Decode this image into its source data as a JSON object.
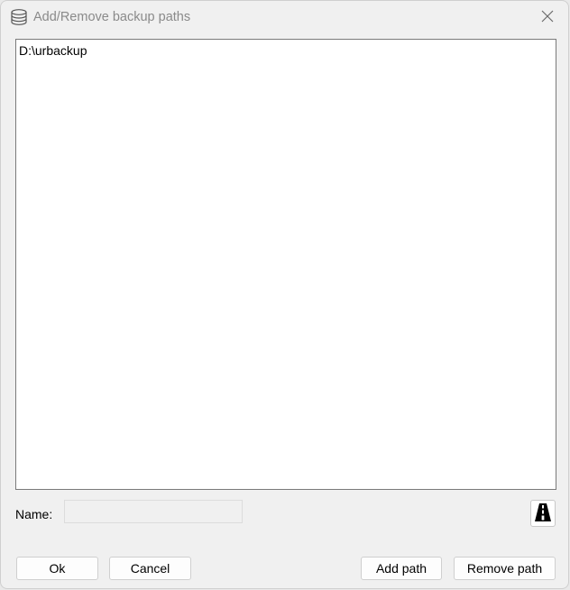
{
  "window": {
    "title": "Add/Remove backup paths",
    "icon": "database-icon",
    "close_icon": "close-icon"
  },
  "paths_list": {
    "items": [
      "D:\\urbackup"
    ]
  },
  "name_field": {
    "label": "Name:",
    "value": "",
    "placeholder": ""
  },
  "browse_button": {
    "icon": "road-icon"
  },
  "buttons": {
    "ok": "Ok",
    "cancel": "Cancel",
    "add_path": "Add path",
    "remove_path": "Remove path"
  }
}
